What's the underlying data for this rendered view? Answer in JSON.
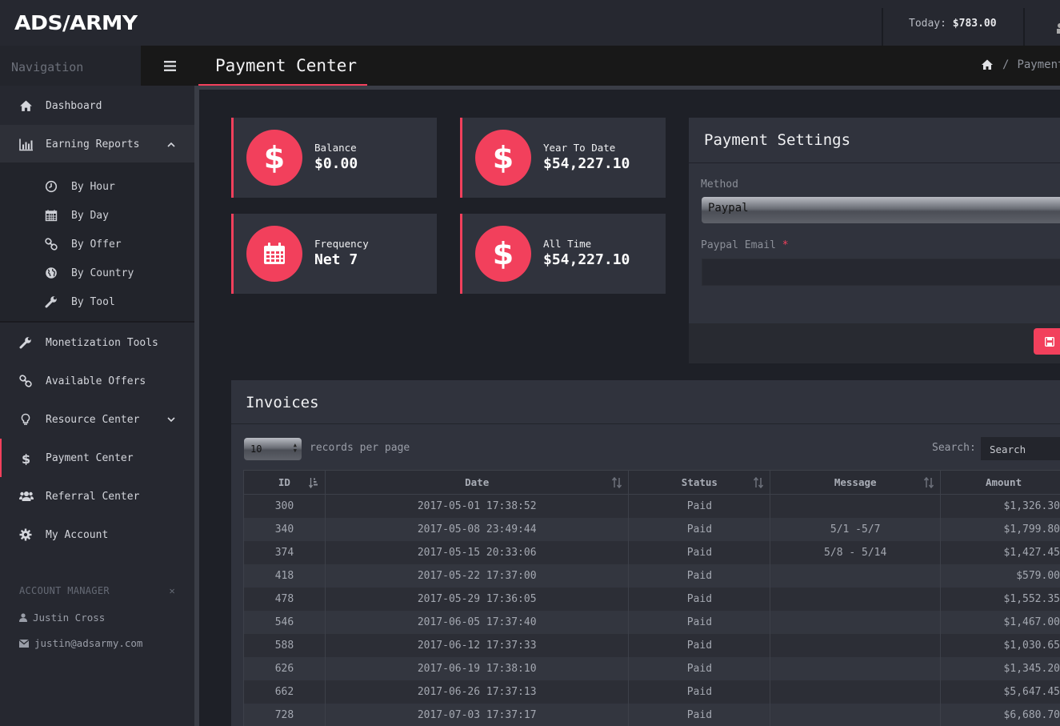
{
  "app": {
    "logo": "ADS/ARMY",
    "today_label": "Today:",
    "today_value": "$783.00"
  },
  "nav": {
    "title": "Navigation",
    "items": [
      {
        "label": "Dashboard",
        "icon": "home-icon"
      },
      {
        "label": "Earning Reports",
        "icon": "bar-chart-icon"
      },
      {
        "label": "Monetization Tools",
        "icon": "wrench-icon"
      },
      {
        "label": "Available Offers",
        "icon": "link-icon"
      },
      {
        "label": "Resource Center",
        "icon": "lightbulb-icon"
      },
      {
        "label": "Payment Center",
        "icon": "dollar-icon"
      },
      {
        "label": "Referral Center",
        "icon": "users-icon"
      },
      {
        "label": "My Account",
        "icon": "gear-icon"
      }
    ],
    "sub_items": [
      {
        "label": "By Hour",
        "icon": "clock-icon"
      },
      {
        "label": "By Day",
        "icon": "calendar-icon"
      },
      {
        "label": "By Offer",
        "icon": "link-icon"
      },
      {
        "label": "By Country",
        "icon": "globe-icon"
      },
      {
        "label": "By Tool",
        "icon": "wrench-icon"
      }
    ]
  },
  "account_manager": {
    "heading": "ACCOUNT MANAGER",
    "name": "Justin Cross",
    "email": "justin@adsarmy.com"
  },
  "page": {
    "title": "Payment Center",
    "breadcrumb": "Payment Center"
  },
  "stats": {
    "balance": {
      "label": "Balance",
      "value": "$0.00"
    },
    "ytd": {
      "label": "Year To Date",
      "value": "$54,227.10"
    },
    "frequency": {
      "label": "Frequency",
      "value": "Net 7"
    },
    "all_time": {
      "label": "All Time",
      "value": "$54,227.10"
    }
  },
  "settings": {
    "title": "Payment Settings",
    "method_label": "Method",
    "method_value": "Paypal",
    "email_label": "Paypal Email",
    "required_mark": "*",
    "email_value": ""
  },
  "invoices": {
    "title": "Invoices",
    "page_length": "10",
    "records_text": "records per page",
    "search_label": "Search:",
    "search_placeholder": "Search",
    "columns": [
      "ID",
      "Date",
      "Status",
      "Message",
      "Amount"
    ],
    "rows": [
      [
        "300",
        "2017-05-01 17:38:52",
        "Paid",
        "",
        "$1,326.30"
      ],
      [
        "340",
        "2017-05-08 23:49:44",
        "Paid",
        "5/1 -5/7",
        "$1,799.80"
      ],
      [
        "374",
        "2017-05-15 20:33:06",
        "Paid",
        "5/8 - 5/14",
        "$1,427.45"
      ],
      [
        "418",
        "2017-05-22 17:37:00",
        "Paid",
        "",
        "$579.00"
      ],
      [
        "478",
        "2017-05-29 17:36:05",
        "Paid",
        "",
        "$1,552.35"
      ],
      [
        "546",
        "2017-06-05 17:37:40",
        "Paid",
        "",
        "$1,467.00"
      ],
      [
        "588",
        "2017-06-12 17:37:33",
        "Paid",
        "",
        "$1,030.65"
      ],
      [
        "626",
        "2017-06-19 17:38:10",
        "Paid",
        "",
        "$1,345.20"
      ],
      [
        "662",
        "2017-06-26 17:37:13",
        "Paid",
        "",
        "$5,647.45"
      ],
      [
        "728",
        "2017-07-03 17:37:17",
        "Paid",
        "",
        "$6,680.70"
      ]
    ]
  },
  "colors": {
    "accent": "#f2405c",
    "background": "#1e2027",
    "panel": "#30333d",
    "sidebar": "#262830"
  }
}
